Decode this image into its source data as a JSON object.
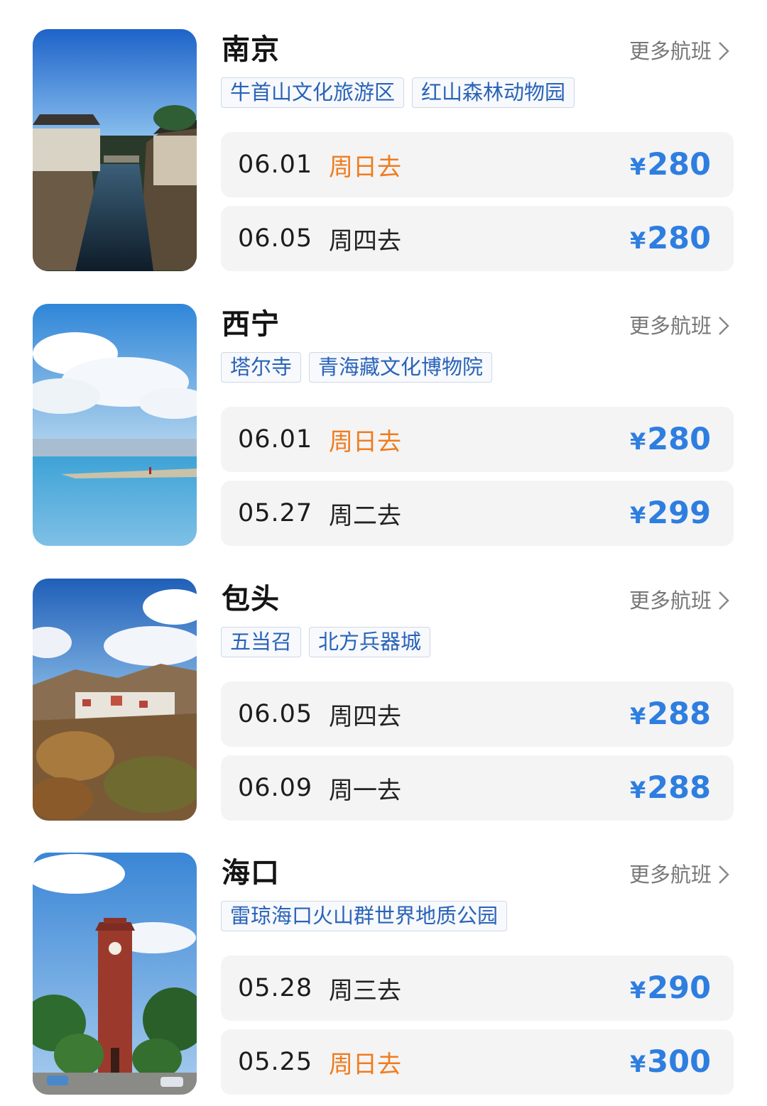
{
  "more_label": "更多航班",
  "currency": "¥",
  "colors": {
    "price": "#2e7ee0",
    "weekend_day": "#f07c1e",
    "tag_text": "#2a63b8",
    "row_bg": "#f4f4f5"
  },
  "destinations": [
    {
      "city": "南京",
      "photo": "canal-town-photo",
      "tags": [
        "牛首山文化旅游区",
        "红山森林动物园"
      ],
      "flights": [
        {
          "date": "06.01",
          "day": "周日去",
          "weekend": true,
          "price": "280"
        },
        {
          "date": "06.05",
          "day": "周四去",
          "weekend": false,
          "price": "280"
        }
      ]
    },
    {
      "city": "西宁",
      "photo": "lake-and-clouds-photo",
      "tags": [
        "塔尔寺",
        "青海藏文化博物院"
      ],
      "flights": [
        {
          "date": "06.01",
          "day": "周日去",
          "weekend": true,
          "price": "280"
        },
        {
          "date": "05.27",
          "day": "周二去",
          "weekend": false,
          "price": "299"
        }
      ]
    },
    {
      "city": "包头",
      "photo": "monastery-hillside-photo",
      "tags": [
        "五当召",
        "北方兵器城"
      ],
      "flights": [
        {
          "date": "06.05",
          "day": "周四去",
          "weekend": false,
          "price": "288"
        },
        {
          "date": "06.09",
          "day": "周一去",
          "weekend": false,
          "price": "288"
        }
      ]
    },
    {
      "city": "海口",
      "photo": "clock-tower-palms-photo",
      "tags": [
        "雷琼海口火山群世界地质公园"
      ],
      "flights": [
        {
          "date": "05.28",
          "day": "周三去",
          "weekend": false,
          "price": "290"
        },
        {
          "date": "05.25",
          "day": "周日去",
          "weekend": true,
          "price": "300"
        }
      ]
    }
  ]
}
